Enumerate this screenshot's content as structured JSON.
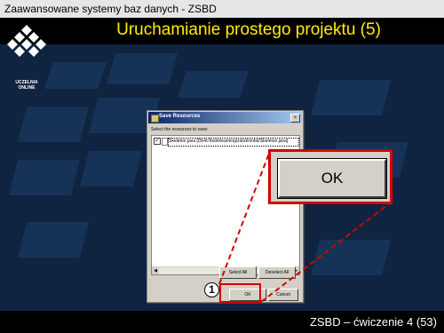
{
  "header": {
    "course_title": "Zaawansowane systemy baz danych - ZSBD",
    "slide_title": "Uruchamianie prostego projektu (5)",
    "logo_text_line1": "UCZELNIA",
    "logo_text_line2": "ONLINE"
  },
  "footer": {
    "slide_number_text": "ZSBD – ćwiczenie 4 (53)"
  },
  "dialog": {
    "title": "Save Resources",
    "prompt": "Select the resources to save:",
    "resources": [
      {
        "checked": true,
        "label": "Skeleton.java  [Db4oTest/elearning/zsbd/niobd/Skeleton.java]"
      }
    ],
    "buttons": {
      "select_all": "Select All",
      "deselect_all": "Deselect All",
      "ok": "OK",
      "cancel": "Cancel"
    }
  },
  "callout": {
    "step_number": "1",
    "zoomed_label": "OK",
    "accent_color": "#d50000"
  },
  "colors": {
    "background": "#0f2440",
    "title_yellow": "#ffee00",
    "dialog_face": "#d4d0c8",
    "titlebar_start": "#0a246a",
    "titlebar_end": "#a6caf0"
  }
}
